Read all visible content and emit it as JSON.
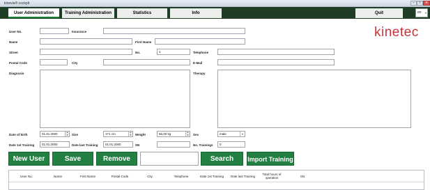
{
  "window": {
    "title": "kinevia® cockpit",
    "min": "–",
    "max": "□",
    "close": "✕"
  },
  "tabs": [
    "User Administration",
    "Training Administration",
    "Statistics",
    "Info"
  ],
  "quit_label": "Quit",
  "language": "en",
  "logo": "kinetec",
  "form": {
    "user_no": "User No.",
    "insurance": "Insurance",
    "name": "Name",
    "first_name": "First Name",
    "street": "Street",
    "no": "No.",
    "no_value": "1",
    "telephone": "Telephone",
    "postal_code": "Postal Code",
    "city": "City",
    "email": "E-Mail",
    "diagnosis": "Diagnosis",
    "therapy": "Therapy",
    "date_of_birth": "Date of birth",
    "date_of_birth_value": "01.01.2000",
    "size": "Size",
    "size_value": "171 cm",
    "weight": "Weight",
    "weight_value": "66,00 kg",
    "sex": "Sex",
    "sex_value": "male",
    "date_first_training": "Date 1st Training",
    "date_first_training_value": "01.01.2000",
    "date_last_training": "Date last Training",
    "date_last_training_value": "01.01.2000",
    "sn": "SN",
    "no_trainings": "No. Trainings",
    "no_trainings_value": "0"
  },
  "buttons": {
    "new_user": "New User",
    "save": "Save",
    "remove": "Remove",
    "search": "Search",
    "import_training": "Import Training"
  },
  "table": {
    "columns": [
      "User No.",
      "Name",
      "First Name",
      "Postal Code",
      "City",
      "Telephone",
      "Date 1st Training",
      "Date last Training",
      "Total hours of operation",
      "SN"
    ]
  },
  "colors": {
    "accent": "#238043",
    "tabbar": "#1f3d24",
    "logo": "#c9343a"
  }
}
